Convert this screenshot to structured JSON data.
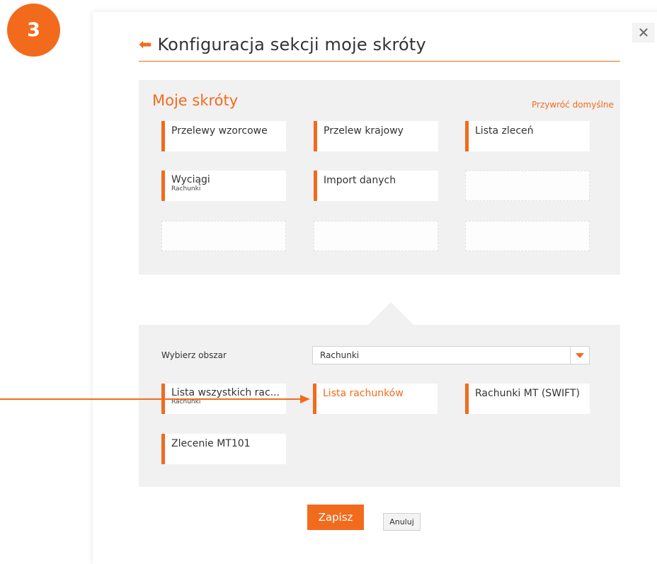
{
  "step": {
    "number": "3"
  },
  "colors": {
    "accent": "#f26b1d",
    "panel": "#f1f1f1"
  },
  "header": {
    "title": "Konfiguracja sekcji moje skróty",
    "back_icon": "back-arrow-icon",
    "close_icon": "close-icon"
  },
  "shortcuts": {
    "title": "Moje skróty",
    "restore_label": "Przywróć domyślne",
    "tiles": [
      {
        "label": "Przelewy wzorcowe",
        "sub": ""
      },
      {
        "label": "Przelew krajowy",
        "sub": ""
      },
      {
        "label": "Lista zleceń",
        "sub": ""
      },
      {
        "label": "Wyciągi",
        "sub": "Rachunki"
      },
      {
        "label": "Import danych",
        "sub": ""
      }
    ],
    "empty_slots": 4
  },
  "area": {
    "label": "Wybierz obszar",
    "selected": "Rachunki",
    "tiles": [
      {
        "label": "Lista wszystkich rac...",
        "sub": "Rachunki",
        "active": false
      },
      {
        "label": "Lista rachunków",
        "sub": "",
        "active": true
      },
      {
        "label": "Rachunki MT (SWIFT)",
        "sub": "",
        "active": false
      },
      {
        "label": "Zlecenie MT101",
        "sub": "",
        "active": false
      }
    ]
  },
  "actions": {
    "save_label": "Zapisz",
    "cancel_label": "Anuluj"
  }
}
